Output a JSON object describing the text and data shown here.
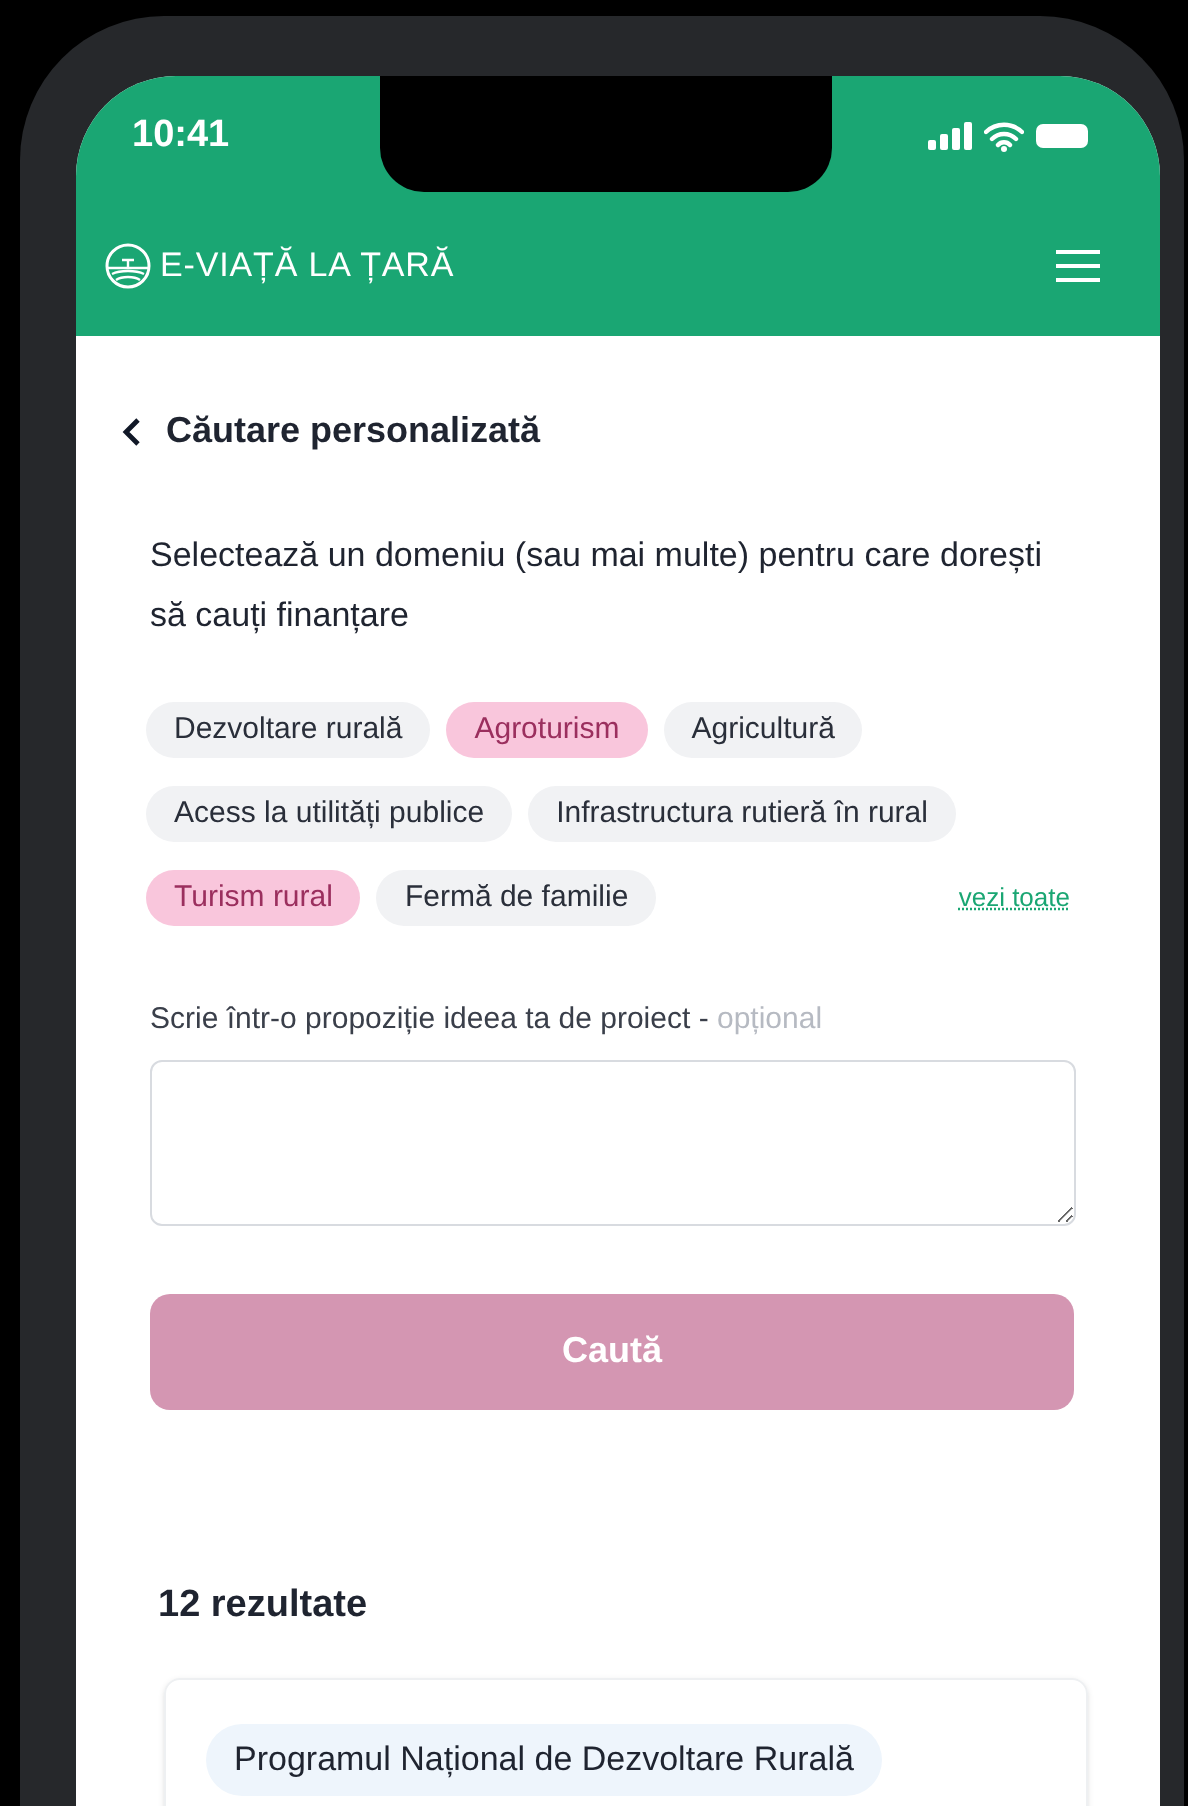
{
  "status_bar": {
    "time": "10:41"
  },
  "header": {
    "title": "E-VIAȚĂ LA ȚARĂ"
  },
  "page": {
    "title": "Căutare personalizată"
  },
  "intro": "Selectează un domeniu (sau mai multe) pentru care dorești să cauți finanțare",
  "domains": [
    {
      "label": "Dezvoltare rurală",
      "selected": false
    },
    {
      "label": "Agroturism",
      "selected": true
    },
    {
      "label": "Agricultură",
      "selected": false
    },
    {
      "label": "Acess la utilități publice",
      "selected": false
    },
    {
      "label": "Infrastructura rutieră în rural",
      "selected": false
    },
    {
      "label": "Turism rural",
      "selected": true
    },
    {
      "label": "Fermă de familie",
      "selected": false
    }
  ],
  "see_all": "vezi toate",
  "idea_field": {
    "label": "Scrie într-o propoziție ideea ta de proiect -",
    "hint": "opțional"
  },
  "search_button": {
    "label": "Caută",
    "disabled": true
  },
  "results": {
    "count": "12 rezultate",
    "items": [
      {
        "program": "Programul Național de Dezvoltare Rurală"
      }
    ]
  }
}
